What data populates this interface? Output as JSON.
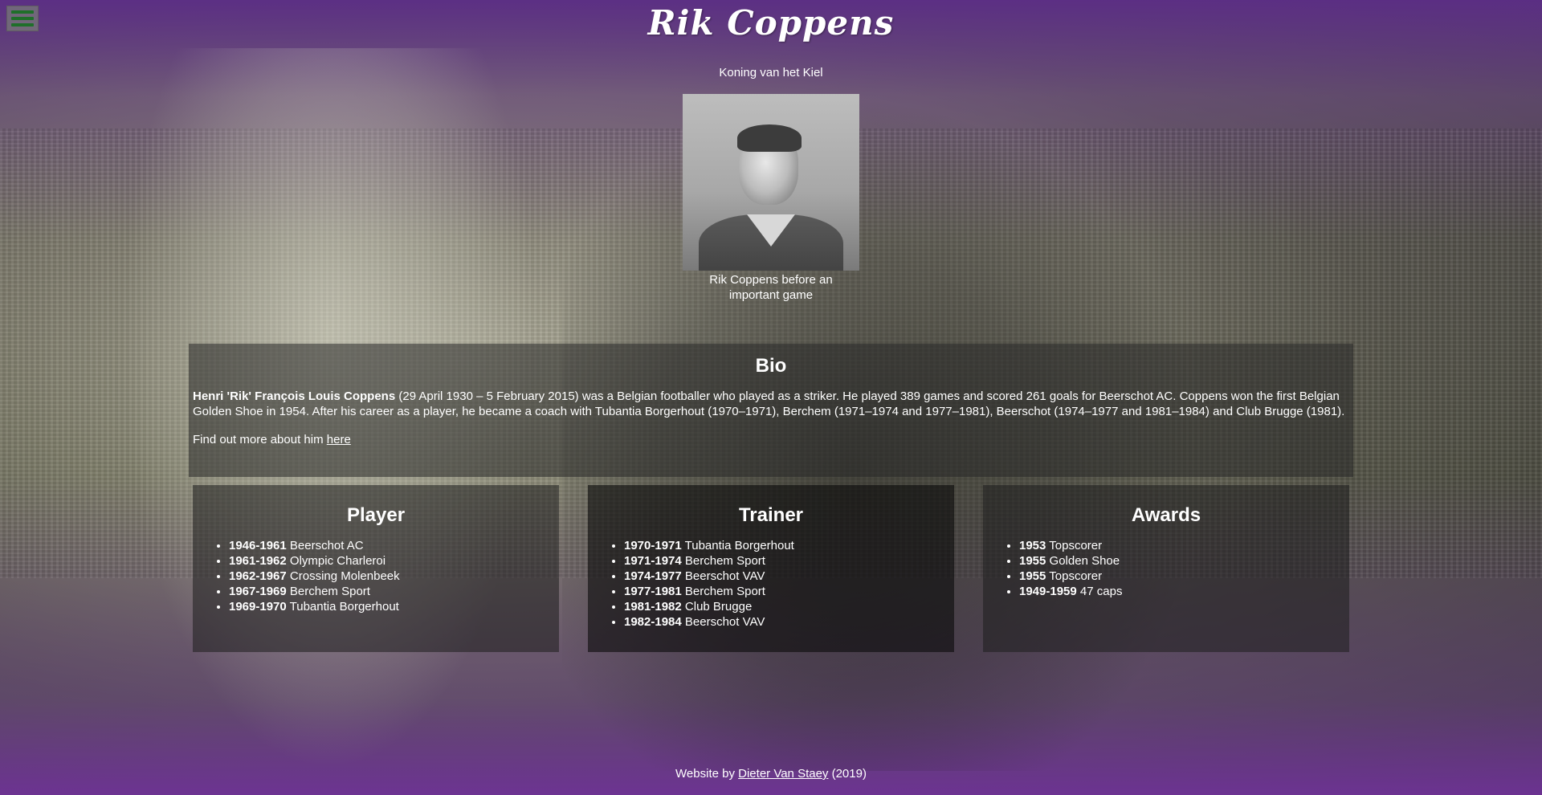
{
  "header": {
    "title": "Rik Coppens",
    "subtitle": "Koning van het Kiel",
    "menu_icon": "hamburger-menu-icon"
  },
  "portrait": {
    "caption": "Rik Coppens before an important game"
  },
  "bio": {
    "heading": "Bio",
    "name": "Henri 'Rik' François Louis Coppens",
    "text": " (29 April 1930 – 5 February 2015) was a Belgian footballer who played as a striker. He played 389 games and scored 261 goals for Beerschot AC. Coppens won the first Belgian Golden Shoe in 1954. After his career as a player, he became a coach with Tubantia Borgerhout (1970–1971), Berchem (1971–1974 and 1977–1981), Beerschot (1974–1977 and 1981–1984) and Club Brugge (1981).",
    "more_prefix": "Find out more about him ",
    "more_link": "here"
  },
  "player": {
    "heading": "Player",
    "items": [
      {
        "years": "1946-1961",
        "club": " Beerschot AC"
      },
      {
        "years": "1961-1962",
        "club": " Olympic Charleroi"
      },
      {
        "years": "1962-1967",
        "club": " Crossing Molenbeek"
      },
      {
        "years": "1967-1969",
        "club": " Berchem Sport"
      },
      {
        "years": "1969-1970",
        "club": " Tubantia Borgerhout"
      }
    ]
  },
  "trainer": {
    "heading": "Trainer",
    "items": [
      {
        "years": "1970-1971",
        "club": " Tubantia Borgerhout"
      },
      {
        "years": "1971-1974",
        "club": " Berchem Sport"
      },
      {
        "years": "1974-1977",
        "club": " Beerschot VAV"
      },
      {
        "years": "1977-1981",
        "club": " Berchem Sport"
      },
      {
        "years": "1981-1982",
        "club": " Club Brugge"
      },
      {
        "years": "1982-1984",
        "club": " Beerschot VAV"
      }
    ]
  },
  "awards": {
    "heading": "Awards",
    "items": [
      {
        "years": "1953",
        "club": " Topscorer"
      },
      {
        "years": "1955",
        "club": " Golden Shoe"
      },
      {
        "years": "1955",
        "club": " Topscorer"
      },
      {
        "years": "1949-1959",
        "club": " 47 caps"
      }
    ]
  },
  "footer": {
    "prefix": "Website by ",
    "author": "Dieter Van Staey",
    "suffix": " (2019)"
  },
  "colors": {
    "accent_purple": "#5c2d87",
    "menu_icon_green": "#1f6f2a"
  }
}
